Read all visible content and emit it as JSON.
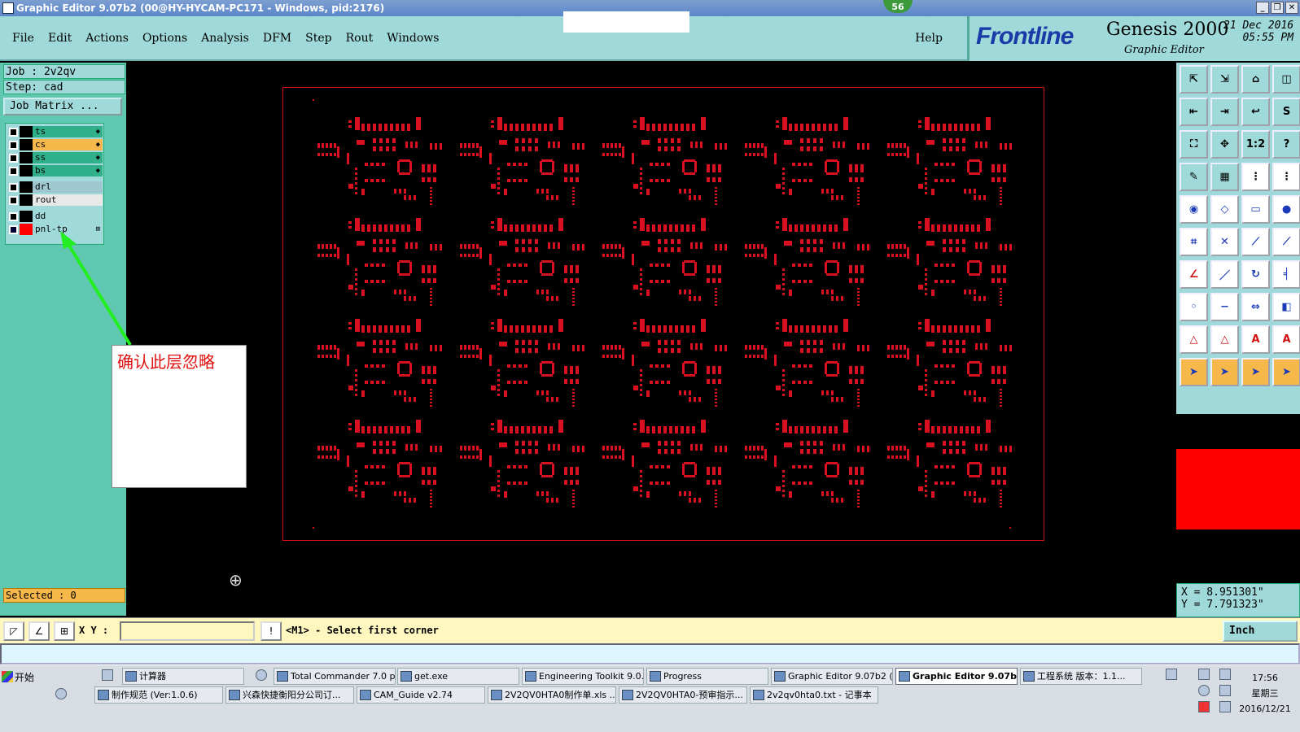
{
  "window": {
    "title": "Graphic Editor 9.07b2 (00@HY-HYCAM-PC171 - Windows, pid:2176)",
    "notification_count": "56"
  },
  "menu": {
    "items": [
      "File",
      "Edit",
      "Actions",
      "Options",
      "Analysis",
      "DFM",
      "Step",
      "Rout",
      "Windows"
    ],
    "help": "Help"
  },
  "branding": {
    "frontline": "Frontline",
    "product": "Genesis 2000",
    "module": "Graphic Editor",
    "date": "21 Dec 2016",
    "time": "05:55 PM"
  },
  "left_panel": {
    "job": "Job : 2v2qv",
    "step": "Step: cad",
    "job_matrix": "Job Matrix ...",
    "layers": [
      {
        "name": "ts",
        "color": "#2fb08a"
      },
      {
        "name": "cs",
        "color": "#f6b84a"
      },
      {
        "name": "ss",
        "color": "#2fb08a"
      },
      {
        "name": "bs",
        "color": "#2fb08a"
      },
      {
        "name": "drl",
        "color": "#9fc7d0"
      },
      {
        "name": "rout",
        "color": "#e8e8e8"
      },
      {
        "name": "dd",
        "color": "#9fd9d9"
      },
      {
        "name": "pnl-tp",
        "color": "#9fd9d9"
      }
    ],
    "selected": "Selected : 0"
  },
  "annotation": {
    "text": "确认此层忽略"
  },
  "canvas": {
    "board_color": "#d01010",
    "pad_color": "#d81020",
    "rows": 4,
    "cols": 5
  },
  "toolbox": {
    "icons": [
      "panel-in-icon",
      "panel-out-icon",
      "home-icon",
      "split-view-icon",
      "pan-left-icon",
      "pan-right-icon",
      "zoom-back-icon",
      "snake-icon",
      "zoom-fit-icon",
      "zoom-center-icon",
      "ratio-icon",
      "help-icon",
      "brush-icon",
      "grid-icon",
      "net-red-icon",
      "net-blue-icon",
      "camera-icon",
      "eraser-icon",
      "ruler-icon",
      "dot-icon",
      "connect-icon",
      "cross-icon",
      "line-node-icon",
      "node-icon",
      "angle-icon",
      "diagonal-icon",
      "rotate-icon",
      "mirror-icon",
      "move-node-icon",
      "minus-icon",
      "stretch-icon",
      "layers-icon",
      "triangle-1-icon",
      "triangle-2-icon",
      "triangle-3-icon",
      "triangle-4-icon",
      "pointer-icon",
      "pointer-box-icon",
      "pointer-round-icon",
      "pointer-multi-icon"
    ],
    "ratio_label": "1:2"
  },
  "coords": {
    "x": "X = 8.951301\"",
    "y": "Y = 7.791323\""
  },
  "command_bar": {
    "xy_label": "X Y :",
    "xy_value": "",
    "message": "<M1> - Select first corner",
    "units": "Inch"
  },
  "taskbar": {
    "start": "开始",
    "row1": [
      "计算器",
      "Total Commander 7.0 p...",
      "get.exe",
      "Engineering Toolkit 9.0...",
      "Progress",
      "Graphic Editor 9.07b2 (...",
      "Graphic Editor 9.07b...",
      "工程系统  版本：1.1..."
    ],
    "row2": [
      "制作规范 (Ver:1.0.6)",
      "兴森快捷衡阳分公司订...",
      "CAM_Guide v2.74",
      "2V2QV0HTA0制作单.xls ...",
      "2V2QV0HTA0-预审指示...",
      "2v2qv0hta0.txt - 记事本"
    ],
    "time": "17:56",
    "weekday": "星期三",
    "date": "2016/12/21"
  }
}
